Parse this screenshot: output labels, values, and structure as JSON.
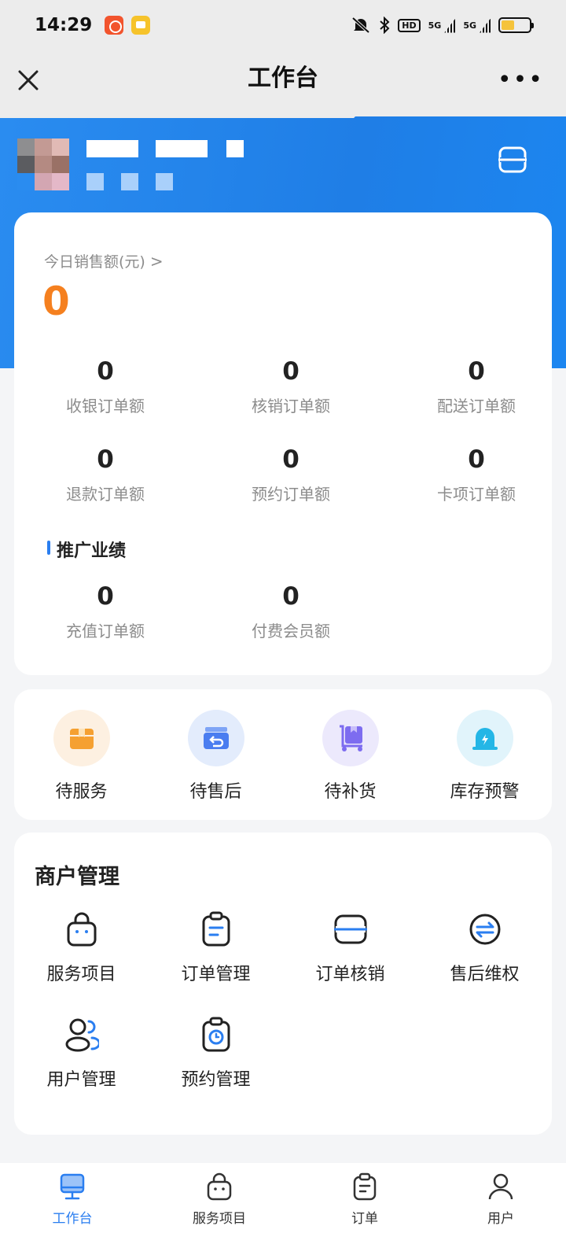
{
  "status_bar": {
    "time": "14:29",
    "hd": "HD",
    "network_1": "5G",
    "network_2": "5G"
  },
  "nav": {
    "title": "工作台"
  },
  "sales": {
    "label": "今日销售额(元)",
    "value": "0"
  },
  "stats": [
    {
      "value": "0",
      "label": "收银订单额"
    },
    {
      "value": "0",
      "label": "核销订单额"
    },
    {
      "value": "0",
      "label": "配送订单额"
    },
    {
      "value": "0",
      "label": "退款订单额"
    },
    {
      "value": "0",
      "label": "预约订单额"
    },
    {
      "value": "0",
      "label": "卡项订单额"
    }
  ],
  "promo": {
    "title": "推广业绩",
    "stats": [
      {
        "value": "0",
        "label": "充值订单额"
      },
      {
        "value": "0",
        "label": "付费会员额"
      }
    ]
  },
  "quick": [
    {
      "label": "待服务",
      "icon": "box-icon",
      "color": "#f5a031",
      "bg": "#fdf0e1"
    },
    {
      "label": "待售后",
      "icon": "return-box-icon",
      "color": "#4a7df0",
      "bg": "#e3ecfc"
    },
    {
      "label": "待补货",
      "icon": "cart-restock-icon",
      "color": "#7d6cf0",
      "bg": "#ece9fc"
    },
    {
      "label": "库存预警",
      "icon": "alarm-icon",
      "color": "#24b6e6",
      "bg": "#e1f4fb"
    }
  ],
  "merchant": {
    "title": "商户管理",
    "items": [
      {
        "label": "服务项目",
        "icon": "bag-icon"
      },
      {
        "label": "订单管理",
        "icon": "clipboard-icon"
      },
      {
        "label": "订单核销",
        "icon": "scan-icon"
      },
      {
        "label": "售后维权",
        "icon": "exchange-icon"
      },
      {
        "label": "用户管理",
        "icon": "users-icon"
      },
      {
        "label": "预约管理",
        "icon": "clock-clipboard-icon"
      }
    ]
  },
  "tabs": [
    {
      "label": "工作台",
      "icon": "monitor-icon",
      "active": true
    },
    {
      "label": "服务项目",
      "icon": "bag-icon",
      "active": false
    },
    {
      "label": "订单",
      "icon": "clipboard-icon",
      "active": false
    },
    {
      "label": "用户",
      "icon": "user-icon",
      "active": false
    }
  ],
  "colors": {
    "brand": "#2a7ef0",
    "accent": "#f5801f"
  }
}
